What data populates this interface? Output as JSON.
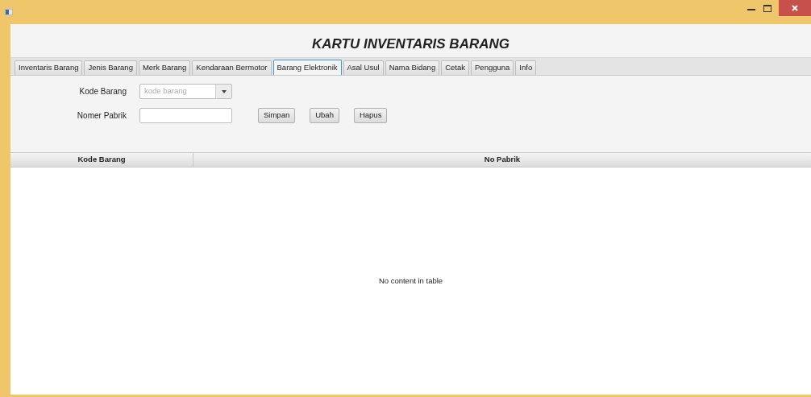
{
  "window": {
    "title": "KARTU INVENTARIS BARANG"
  },
  "tabs": [
    {
      "label": "Inventaris Barang",
      "selected": false
    },
    {
      "label": "Jenis Barang",
      "selected": false
    },
    {
      "label": "Merk Barang",
      "selected": false
    },
    {
      "label": "Kendaraan Bermotor",
      "selected": false
    },
    {
      "label": "Barang Elektronik",
      "selected": true
    },
    {
      "label": "Asal Usul",
      "selected": false
    },
    {
      "label": "Nama Bidang",
      "selected": false
    },
    {
      "label": "Cetak",
      "selected": false
    },
    {
      "label": "Pengguna",
      "selected": false
    },
    {
      "label": "Info",
      "selected": false
    }
  ],
  "form": {
    "fields": [
      {
        "kind": "combo",
        "label": "Kode Barang",
        "placeholder": "kode barang"
      },
      {
        "kind": "text",
        "label": "Nomer Pabrik"
      }
    ],
    "buttons": [
      "Simpan",
      "Ubah",
      "Hapus"
    ]
  },
  "table": {
    "columns": [
      "Kode Barang",
      "No Pabrik"
    ],
    "empty_message": "No content in table"
  }
}
